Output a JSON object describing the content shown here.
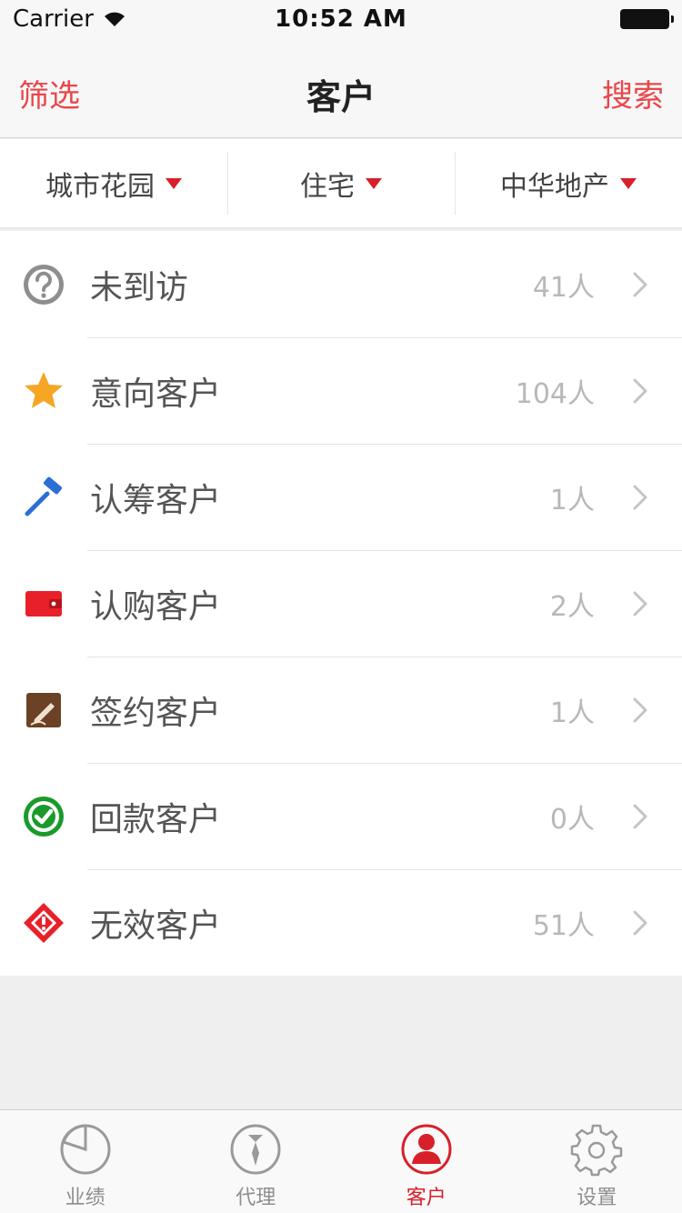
{
  "status_bar": {
    "carrier": "Carrier",
    "time": "10:52 AM"
  },
  "nav": {
    "left_label": "筛选",
    "title": "客户",
    "right_label": "搜索"
  },
  "filters": [
    {
      "label": "城市花园"
    },
    {
      "label": "住宅"
    },
    {
      "label": "中华地产"
    }
  ],
  "list": [
    {
      "icon": "question-icon",
      "label": "未到访",
      "count": "41人",
      "color": "#8e8e8e"
    },
    {
      "icon": "star-icon",
      "label": "意向客户",
      "count": "104人",
      "color": "#f5a623"
    },
    {
      "icon": "gavel-icon",
      "label": "认筹客户",
      "count": "1人",
      "color": "#2b6fd6"
    },
    {
      "icon": "wallet-icon",
      "label": "认购客户",
      "count": "2人",
      "color": "#e8202a"
    },
    {
      "icon": "signature-icon",
      "label": "签约客户",
      "count": "1人",
      "color": "#6b4226"
    },
    {
      "icon": "check-circle-icon",
      "label": "回款客户",
      "count": "0人",
      "color": "#1a9a2a"
    },
    {
      "icon": "invalid-diamond-icon",
      "label": "无效客户",
      "count": "51人",
      "color": "#e8202a"
    }
  ],
  "tabs": [
    {
      "label": "业绩",
      "icon": "performance-icon",
      "active": false
    },
    {
      "label": "代理",
      "icon": "agent-icon",
      "active": false
    },
    {
      "label": "客户",
      "icon": "customer-icon",
      "active": true
    },
    {
      "label": "设置",
      "icon": "settings-icon",
      "active": false
    }
  ],
  "colors": {
    "accent": "#d8202a",
    "nav_action": "#e8474a"
  }
}
